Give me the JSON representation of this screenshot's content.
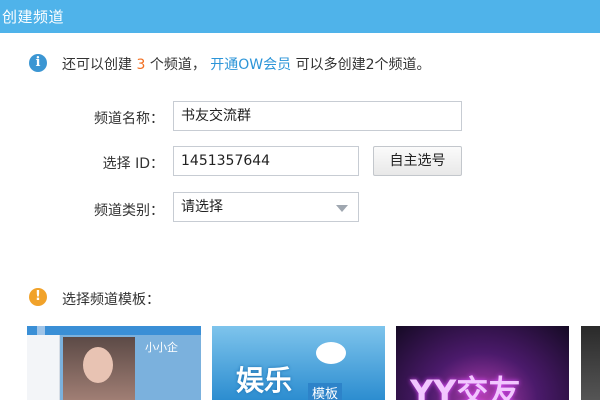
{
  "window": {
    "title": "创建频道"
  },
  "info": {
    "prefix": "还可以创建",
    "count": "3",
    "middle": "个频道，",
    "vip_link": "开通OW会员",
    "suffix": "可以多创建2个频道。"
  },
  "form": {
    "name_label": "频道名称：",
    "name_value": "书友交流群",
    "id_label": "选择 ID：",
    "id_value": "1451357644",
    "choose_button": "自主选号",
    "category_label": "频道类别：",
    "category_value": "请选择"
  },
  "templates": {
    "heading": "选择频道模板：",
    "items": [
      {
        "text": "小小企"
      },
      {
        "text": "娱乐",
        "subtext": "模板"
      },
      {
        "text": "YY交友"
      },
      {
        "text": ""
      }
    ]
  },
  "colors": {
    "titlebar": "#4fb3ea",
    "accent_count": "#f26e20",
    "link": "#2c95d8"
  }
}
